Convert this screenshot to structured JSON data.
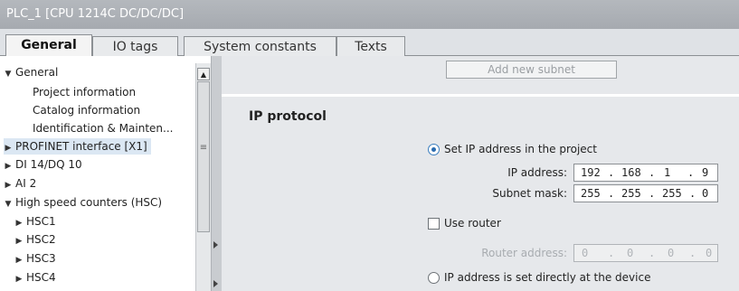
{
  "window": {
    "title": "PLC_1 [CPU 1214C DC/DC/DC]"
  },
  "tabs": [
    {
      "label": "General"
    },
    {
      "label": "IO tags"
    },
    {
      "label": "System constants"
    },
    {
      "label": "Texts"
    }
  ],
  "tree": {
    "items": [
      {
        "label": "General",
        "arrow": "▼"
      },
      {
        "label": "Project information",
        "arrow": ""
      },
      {
        "label": "Catalog information",
        "arrow": ""
      },
      {
        "label": "Identification & Mainten...",
        "arrow": ""
      },
      {
        "label": "PROFINET interface [X1]",
        "arrow": "▶"
      },
      {
        "label": "DI 14/DQ 10",
        "arrow": "▶"
      },
      {
        "label": "AI 2",
        "arrow": "▶"
      },
      {
        "label": "High speed counters (HSC)",
        "arrow": "▼"
      },
      {
        "label": "HSC1",
        "arrow": "▶"
      },
      {
        "label": "HSC2",
        "arrow": "▶"
      },
      {
        "label": "HSC3",
        "arrow": "▶"
      },
      {
        "label": "HSC4",
        "arrow": "▶"
      }
    ]
  },
  "content": {
    "add_subnet_label": "Add new subnet",
    "section_title": "IP protocol",
    "set_ip_label": "Set IP address in the project",
    "ip_address_label": "IP address:",
    "ip_address": [
      "192",
      "168",
      "1",
      "9"
    ],
    "subnet_mask_label": "Subnet mask:",
    "subnet_mask": [
      "255",
      "255",
      "255",
      "0"
    ],
    "use_router_label": "Use router",
    "router_address_label": "Router address:",
    "router_address": [
      "0",
      "0",
      "0",
      "0"
    ],
    "ip_at_device_label": "IP address is set directly at the device"
  },
  "colors": {
    "accent": "#2b6cb0",
    "title_bar": "#aaaeb3",
    "selection": "#dbe7f3"
  }
}
